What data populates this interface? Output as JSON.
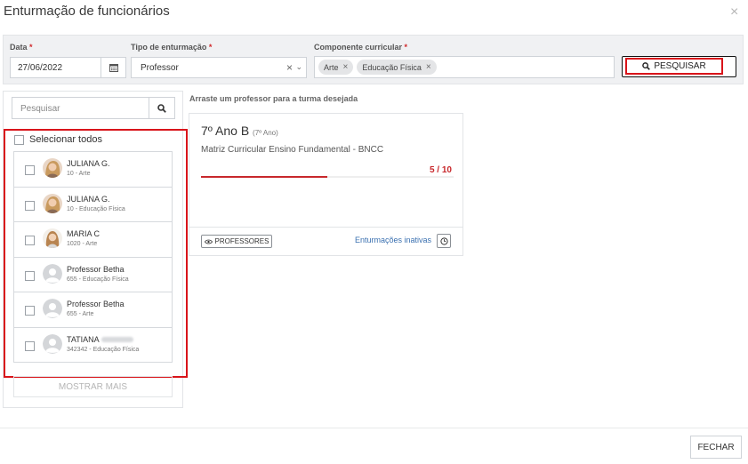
{
  "modal": {
    "title": "Enturmação de funcionários",
    "close_icon": "×"
  },
  "filters": {
    "date": {
      "label": "Data",
      "required": "*",
      "value": "27/06/2022"
    },
    "tipo": {
      "label": "Tipo de enturmação",
      "required": "*",
      "value": "Professor"
    },
    "componente": {
      "label": "Componente curricular",
      "required": "*",
      "chips": [
        "Arte",
        "Educação Física"
      ]
    },
    "search_button": "PESQUISAR"
  },
  "sidebar": {
    "search_placeholder": "Pesquisar",
    "select_all": "Selecionar todos",
    "teachers": [
      {
        "name": "JULIANA G.",
        "sub": "10 - Arte",
        "avatar": "photo-a"
      },
      {
        "name": "JULIANA G.",
        "sub": "10 - Educação Física",
        "avatar": "photo-a"
      },
      {
        "name": "MARIA C",
        "sub": "1020 - Arte",
        "avatar": "photo-b"
      },
      {
        "name": "Professor Betha",
        "sub": "655 - Educação Física",
        "avatar": "placeholder"
      },
      {
        "name": "Professor Betha",
        "sub": "655 - Arte",
        "avatar": "placeholder"
      },
      {
        "name": "TATIANA",
        "sub": "342342 - Educação Física",
        "avatar": "placeholder",
        "redacted": true
      }
    ],
    "more_button": "MOSTRAR MAIS"
  },
  "main": {
    "hint": "Arraste um professor para a turma desejada",
    "class_card": {
      "title": "7º Ano B",
      "subtitle": "(7º Ano)",
      "matrix": "Matriz Curricular Ensino Fundamental - BNCC",
      "count": "5 / 10",
      "filled": 5,
      "capacity": 10,
      "professors_button": "PROFESSORES",
      "inactive_link": "Enturmações inativas"
    }
  },
  "footer": {
    "close_button": "FECHAR"
  }
}
